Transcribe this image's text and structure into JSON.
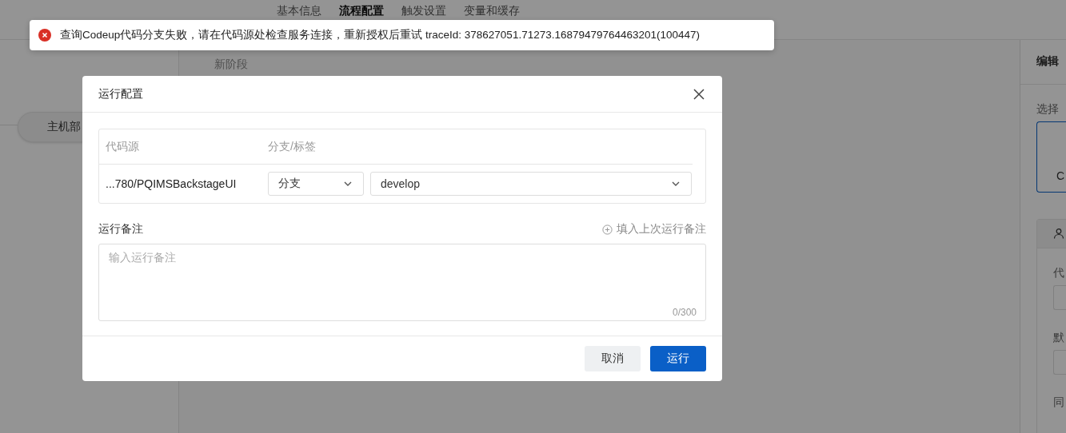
{
  "page_tabs": [
    {
      "label": "基本信息",
      "selected": false
    },
    {
      "label": "流程配置",
      "selected": true
    },
    {
      "label": "触发设置",
      "selected": false
    },
    {
      "label": "变量和缓存",
      "selected": false
    }
  ],
  "sidebar": {
    "stage_button": "主机部"
  },
  "canvas": {
    "stage_title": "新阶段"
  },
  "side_panel": {
    "title": "编辑",
    "source_label": "选择",
    "source_card": "C",
    "section_fields": [
      "代",
      "默"
    ],
    "section_labels": [
      "同"
    ]
  },
  "toast": {
    "kind": "error",
    "message": "查询Codeup代码分支失败，请在代码源处检查服务连接，重新授权后重试 traceId: 378627051.71273.16879479764463201(100447)"
  },
  "dialog": {
    "title": "运行配置",
    "columns": [
      "代码源",
      "分支/标签"
    ],
    "rows": [
      {
        "source": "...780/PQIMSBackstageUI",
        "ref_type": "分支",
        "ref": "develop"
      }
    ],
    "remark": {
      "label": "运行备注",
      "fill_link": "填入上次运行备注",
      "placeholder": "输入运行备注",
      "counter": "0/300"
    },
    "buttons": [
      {
        "label": "取消",
        "kind": "secondary"
      },
      {
        "label": "运行",
        "kind": "primary"
      }
    ]
  }
}
